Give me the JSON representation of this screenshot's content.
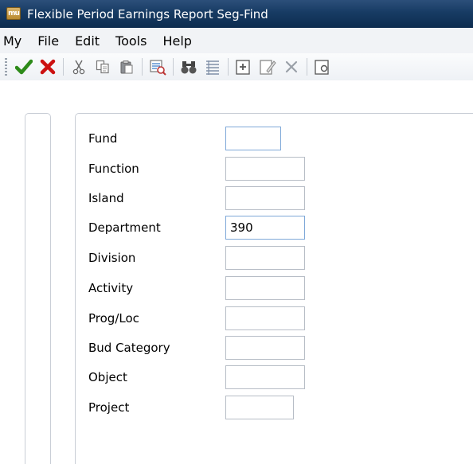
{
  "window": {
    "app_icon_text": "mu",
    "title": "Flexible Period Earnings Report Seg-Find"
  },
  "menu": [
    "My",
    "File",
    "Edit",
    "Tools",
    "Help"
  ],
  "toolbar": {
    "buttons": [
      "accept-icon",
      "cancel-icon",
      "cut-icon",
      "copy-icon",
      "paste-icon",
      "query-icon",
      "find-icon",
      "list-icon",
      "new-record-icon",
      "edit-record-icon",
      "delete-icon",
      "preview-icon"
    ],
    "colors": {
      "accept": "#2e8b1a",
      "cancel": "#cc1111"
    }
  },
  "form": {
    "fields": [
      {
        "label": "Fund",
        "value": ""
      },
      {
        "label": "Function",
        "value": ""
      },
      {
        "label": "Island",
        "value": ""
      },
      {
        "label": "Department",
        "value": "390"
      },
      {
        "label": "Division",
        "value": ""
      },
      {
        "label": "Activity",
        "value": ""
      },
      {
        "label": "Prog/Loc",
        "value": ""
      },
      {
        "label": "Bud Category",
        "value": ""
      },
      {
        "label": "Object",
        "value": ""
      },
      {
        "label": "Project",
        "value": ""
      }
    ]
  }
}
